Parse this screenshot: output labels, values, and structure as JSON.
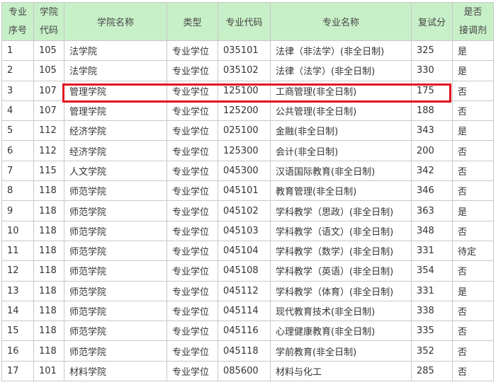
{
  "headers": {
    "seq": [
      "专业",
      "序号"
    ],
    "code": [
      "学院",
      "代码"
    ],
    "college": "学院名称",
    "type": "类型",
    "major_code": "专业代码",
    "major_name": "专业名称",
    "score": "复试分",
    "adjust": [
      "是否",
      "接调剂"
    ]
  },
  "rows": [
    [
      "1",
      "105",
      "法学院",
      "专业学位",
      "035101",
      "法律（非法学）(非全日制)",
      "325",
      "是"
    ],
    [
      "2",
      "105",
      "法学院",
      "专业学位",
      "035102",
      "法律（法学）(非全日制)",
      "330",
      "是"
    ],
    [
      "3",
      "107",
      "管理学院",
      "专业学位",
      "125100",
      "工商管理(非全日制)",
      "175",
      "否"
    ],
    [
      "4",
      "107",
      "管理学院",
      "专业学位",
      "125200",
      "公共管理(非全日制)",
      "188",
      "否"
    ],
    [
      "5",
      "112",
      "经济学院",
      "专业学位",
      "025100",
      "金融(非全日制)",
      "343",
      "是"
    ],
    [
      "6",
      "112",
      "经济学院",
      "专业学位",
      "125300",
      "会计(非全日制)",
      "200",
      "否"
    ],
    [
      "7",
      "115",
      "人文学院",
      "专业学位",
      "045300",
      "汉语国际教育(非全日制)",
      "342",
      "否"
    ],
    [
      "8",
      "118",
      "师范学院",
      "专业学位",
      "045101",
      "教育管理(非全日制)",
      "346",
      "否"
    ],
    [
      "9",
      "118",
      "师范学院",
      "专业学位",
      "045102",
      "学科教学（思政）(非全日制)",
      "363",
      "是"
    ],
    [
      "10",
      "118",
      "师范学院",
      "专业学位",
      "045103",
      "学科教学（语文）(非全日制)",
      "348",
      "否"
    ],
    [
      "11",
      "118",
      "师范学院",
      "专业学位",
      "045104",
      "学科教学（数学）(非全日制)",
      "331",
      "待定"
    ],
    [
      "12",
      "118",
      "师范学院",
      "专业学位",
      "045108",
      "学科教学（英语）(非全日制)",
      "354",
      "否"
    ],
    [
      "13",
      "118",
      "师范学院",
      "专业学位",
      "045112",
      "学科教学（体育）(非全日制)",
      "331",
      "是"
    ],
    [
      "14",
      "118",
      "师范学院",
      "专业学位",
      "045114",
      "现代教育技术(非全日制)",
      "338",
      "否"
    ],
    [
      "15",
      "118",
      "师范学院",
      "专业学位",
      "045116",
      "心理健康教育(非全日制)",
      "335",
      "否"
    ],
    [
      "16",
      "118",
      "师范学院",
      "专业学位",
      "045118",
      "学前教育(非全日制)",
      "352",
      "否"
    ],
    [
      "17",
      "101",
      "材料学院",
      "专业学位",
      "085600",
      "材料与化工",
      "285",
      "否"
    ]
  ],
  "highlight_row_index": 2,
  "colors": {
    "header_bg": "#c8f0c8",
    "border": "#c8c8c8",
    "highlight": "#e0141e"
  }
}
